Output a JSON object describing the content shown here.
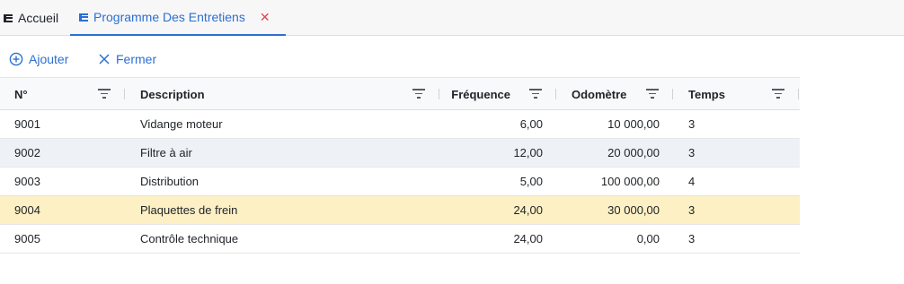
{
  "tabs": {
    "home_label": "Accueil",
    "active_label": "Programme Des Entretiens",
    "close_glyph": "✕"
  },
  "toolbar": {
    "add_label": "Ajouter",
    "close_label": "Fermer"
  },
  "grid": {
    "columns": [
      "N°",
      "Description",
      "Fréquence",
      "Odomètre",
      "Temps"
    ],
    "rows": [
      {
        "num": "9001",
        "description": "Vidange moteur",
        "frequence": "6,00",
        "odometre": "10 000,00",
        "temps": "3"
      },
      {
        "num": "9002",
        "description": "Filtre à air",
        "frequence": "12,00",
        "odometre": "20 000,00",
        "temps": "3"
      },
      {
        "num": "9003",
        "description": "Distribution",
        "frequence": "5,00",
        "odometre": "100 000,00",
        "temps": "4"
      },
      {
        "num": "9004",
        "description": "Plaquettes de frein",
        "frequence": "24,00",
        "odometre": "30 000,00",
        "temps": "3"
      },
      {
        "num": "9005",
        "description": "Contrôle technique",
        "frequence": "24,00",
        "odometre": "0,00",
        "temps": "3"
      }
    ],
    "selected_row": "9004"
  },
  "colors": {
    "accent": "#2c6fd1",
    "close_red": "#e0474c",
    "selected_row_bg": "#fcf0c4",
    "alt_row_bg": "#eef2f7"
  }
}
